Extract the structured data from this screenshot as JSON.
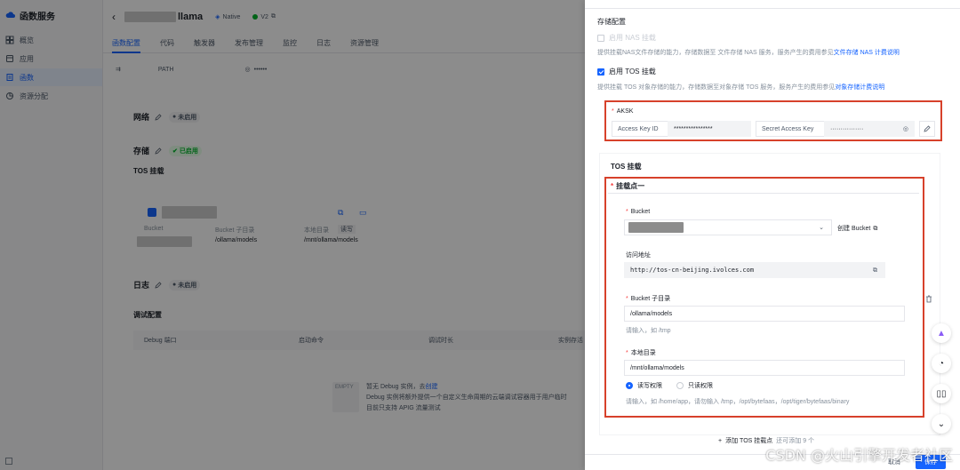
{
  "sidebar": {
    "brand": "函数服务",
    "items": [
      {
        "label": "概览",
        "icon": "overview-icon"
      },
      {
        "label": "应用",
        "icon": "app-icon"
      },
      {
        "label": "函数",
        "icon": "function-icon",
        "active": true
      },
      {
        "label": "资源分配",
        "icon": "resource-icon"
      }
    ]
  },
  "header": {
    "title_suffix": "llama",
    "runtime": "Native",
    "version": "V2"
  },
  "tabs": [
    "函数配置",
    "代码",
    "触发器",
    "发布管理",
    "监控",
    "日志",
    "资源管理"
  ],
  "env": {
    "key": "PATH",
    "value": "••••••"
  },
  "sections": {
    "network": {
      "label": "网络",
      "status": "未启用"
    },
    "storage": {
      "label": "存储",
      "status": "已启用"
    },
    "tos_mount": {
      "label": "TOS 挂载"
    },
    "log": {
      "label": "日志",
      "status": "未启用"
    },
    "debug": {
      "label": "调试配置"
    }
  },
  "tos_card": {
    "bucket_label": "Bucket",
    "subdir_label": "Bucket 子目录",
    "subdir_value": "/ollama/models",
    "local_label": "本地目录",
    "local_badge": "读写",
    "local_value": "/mnt/ollama/models"
  },
  "debug_table": {
    "headers": [
      "Debug 端口",
      "启动命令",
      "调试时长",
      "实例存活"
    ]
  },
  "empty_state": {
    "icon_text": "EMPTY",
    "line1": "暂无 Debug 实例，去",
    "line1_link": "创建",
    "line2": "Debug 实例将额外提供一个自定义生命周期的云端调试容器用于用户临时",
    "line3": "目前只支持 APIG 流量测试"
  },
  "drawer": {
    "storage_title": "存储配置",
    "nas_label": "启用 NAS 挂载",
    "nas_hint": "提供挂载NAS文件存储的能力，存储数据至 文件存储 NAS 服务，服务产生的费用参见",
    "nas_hint_link": "文件存储 NAS 计费说明",
    "tos_label": "启用 TOS 挂载",
    "tos_hint": "提供挂载 TOS 对象存储的能力，存储数据至对象存储 TOS 服务，服务产生的费用参见",
    "tos_hint_link": "对象存储计费说明",
    "aksk_label": "AKSK",
    "ak_addon": "Access Key ID",
    "ak_value": "****************",
    "sk_addon": "Secret Access Key",
    "sk_value": "················",
    "tos_mount_title": "TOS 挂载",
    "mount_point": "挂载点一",
    "bucket_label": "Bucket",
    "create_bucket": "创建 Bucket",
    "access_label": "访问地址",
    "access_value": "http://tos-cn-beijing.ivolces.com",
    "subdir_label": "Bucket 子目录",
    "subdir_value": "/ollama/models",
    "subdir_hint": "请输入，如 /tmp",
    "local_label": "本地目录",
    "local_value": "/mnt/ollama/models",
    "perm_rw": "读写权限",
    "perm_ro": "只读权限",
    "local_hint": "请输入，如 /home/app，请勿输入 /tmp，/opt/bytefaas，/opt/tiger/bytefaas/binary",
    "add_mount": "添加 TOS 挂载点",
    "add_mount_hint": "还可添加 9 个",
    "cancel": "取消",
    "save": "保存"
  },
  "watermark": "CSDN @火山引擎开发者社区",
  "colors": {
    "primary": "#1664ff",
    "highlight": "#d7412b",
    "success": "#00b42a"
  }
}
